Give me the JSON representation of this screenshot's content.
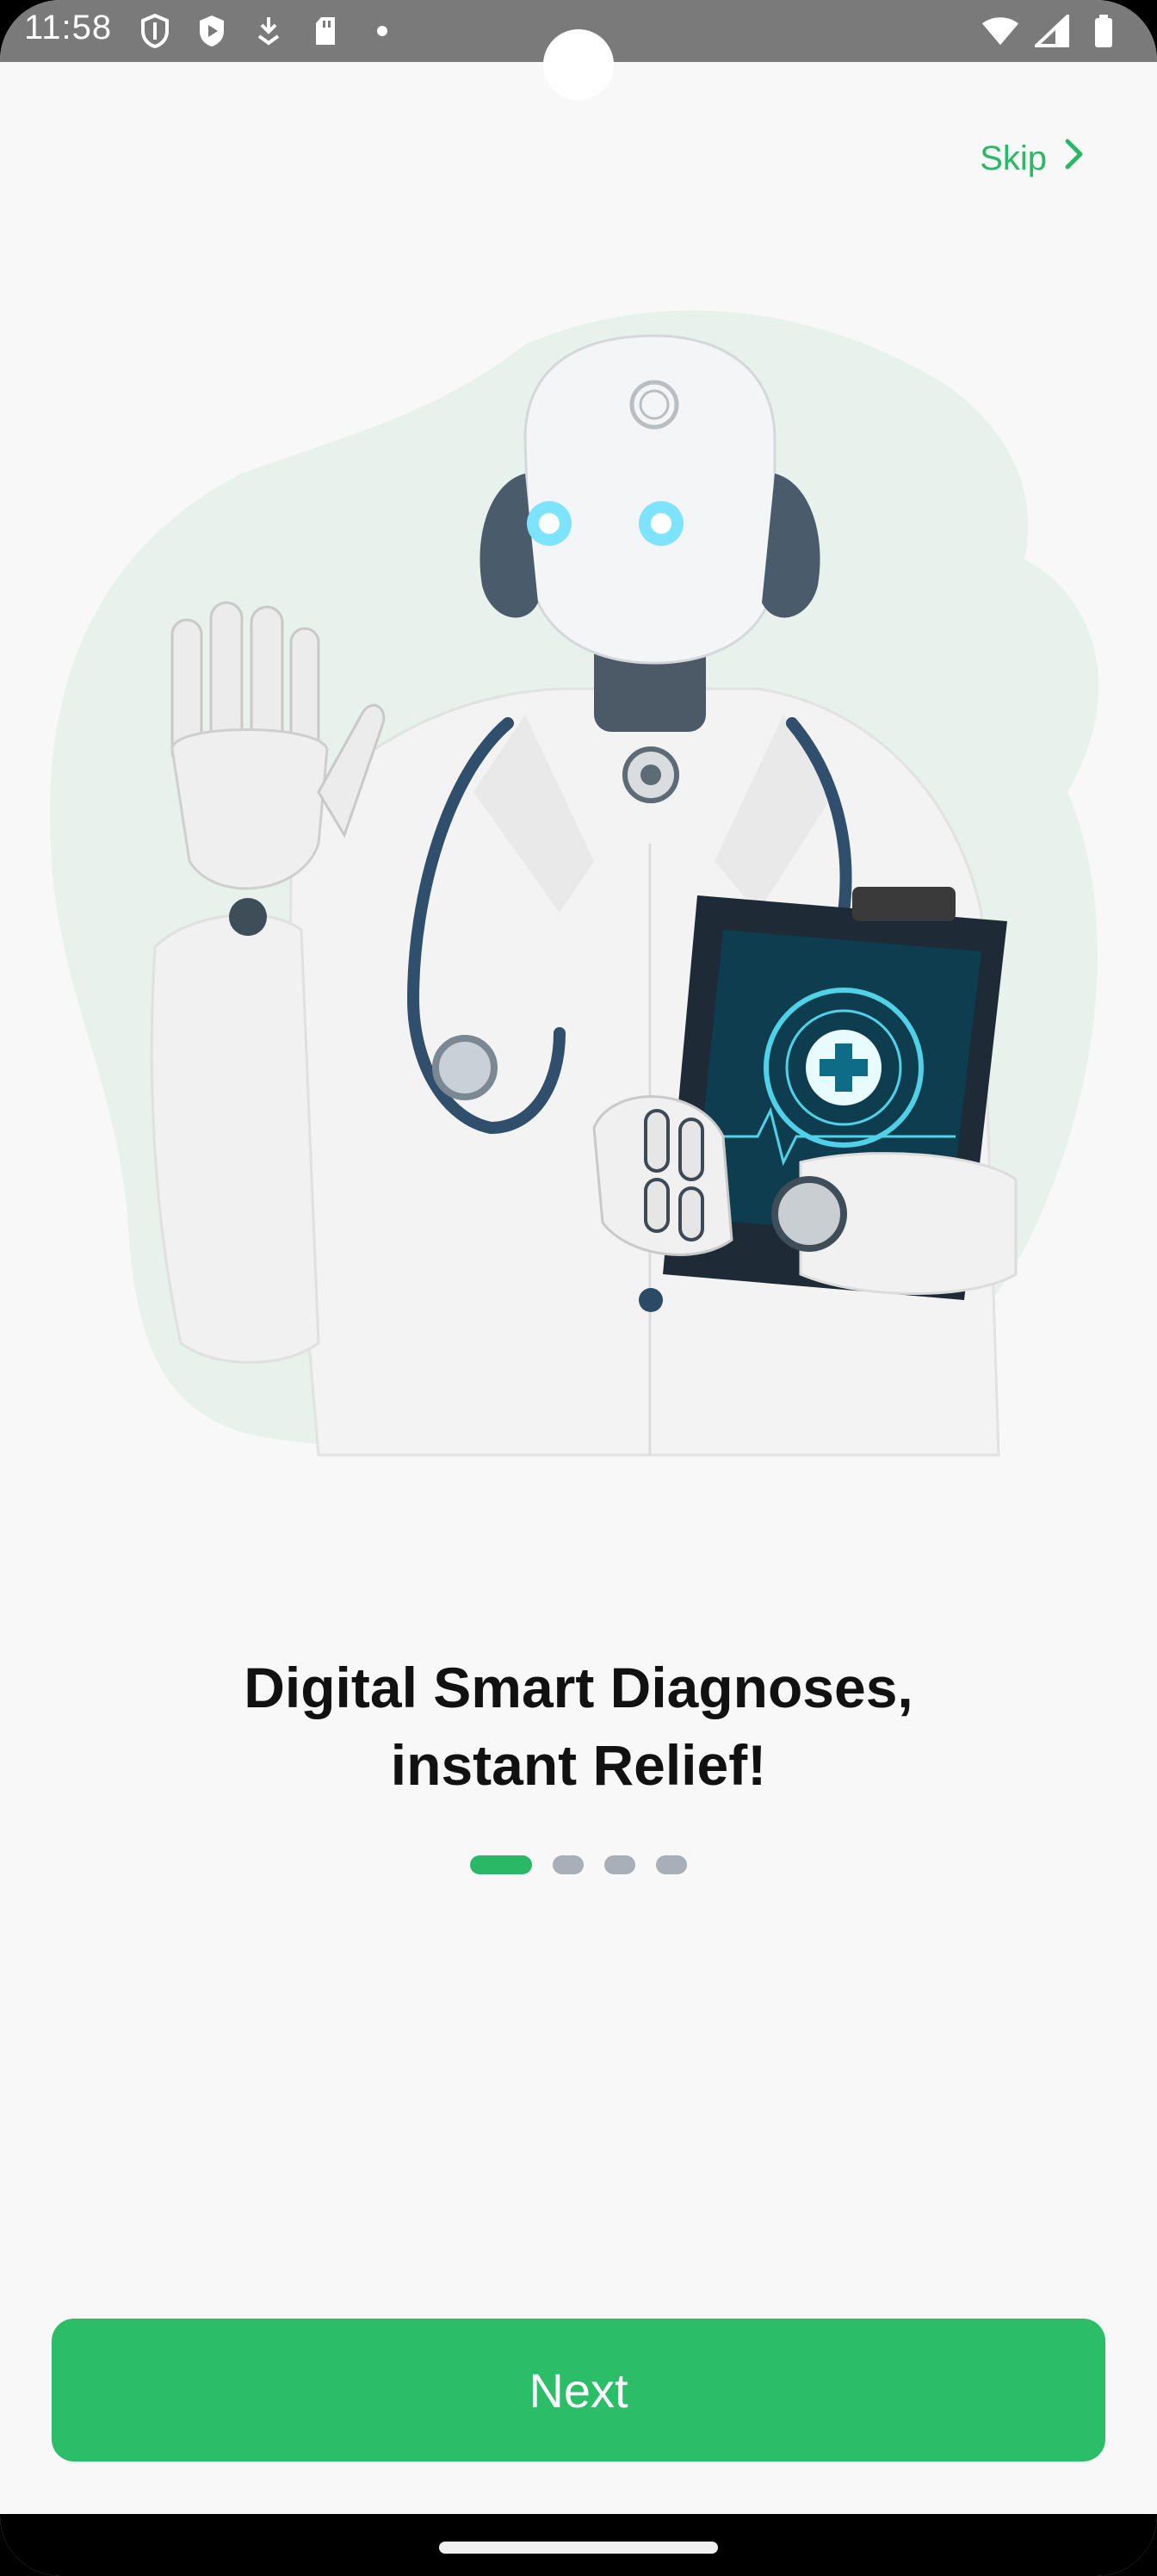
{
  "status_bar": {
    "time": "11:58",
    "left_icons": [
      "shield-icon",
      "play-shield-icon",
      "download-icon",
      "sd-card-icon",
      "dot-icon"
    ],
    "right_icons": [
      "wifi-icon",
      "signal-icon",
      "battery-icon"
    ]
  },
  "header": {
    "skip_label": "Skip"
  },
  "onboarding": {
    "title_line1": "Digital Smart Diagnoses,",
    "title_line2": "instant Relief!",
    "page_count": 4,
    "current_page": 1
  },
  "footer": {
    "next_label": "Next"
  },
  "colors": {
    "accent": "#2bb866",
    "button": "#2bbd67",
    "dot_inactive": "#a7b0b8",
    "blob": "#e6f2eb"
  }
}
